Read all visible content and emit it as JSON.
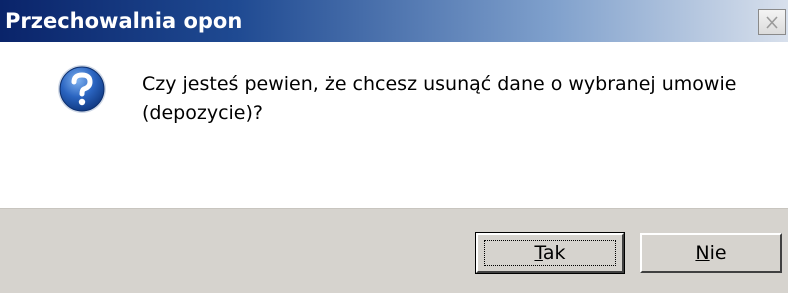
{
  "window": {
    "title": "Przechowalnia opon"
  },
  "message": {
    "line1": "Czy jesteś pewien, że chcesz usunąć dane o wybranej umowie",
    "line2": "(depozycie)?",
    "icon": "question-icon"
  },
  "buttons": {
    "yes": {
      "mnemonic": "T",
      "rest": "ak"
    },
    "no": {
      "mnemonic": "N",
      "rest": "ie"
    }
  },
  "colors": {
    "titlebar_start": "#0a246a",
    "titlebar_end": "#d8e0ec",
    "button_face": "#d6d3ce",
    "icon_blue": "#1e5aa8"
  }
}
